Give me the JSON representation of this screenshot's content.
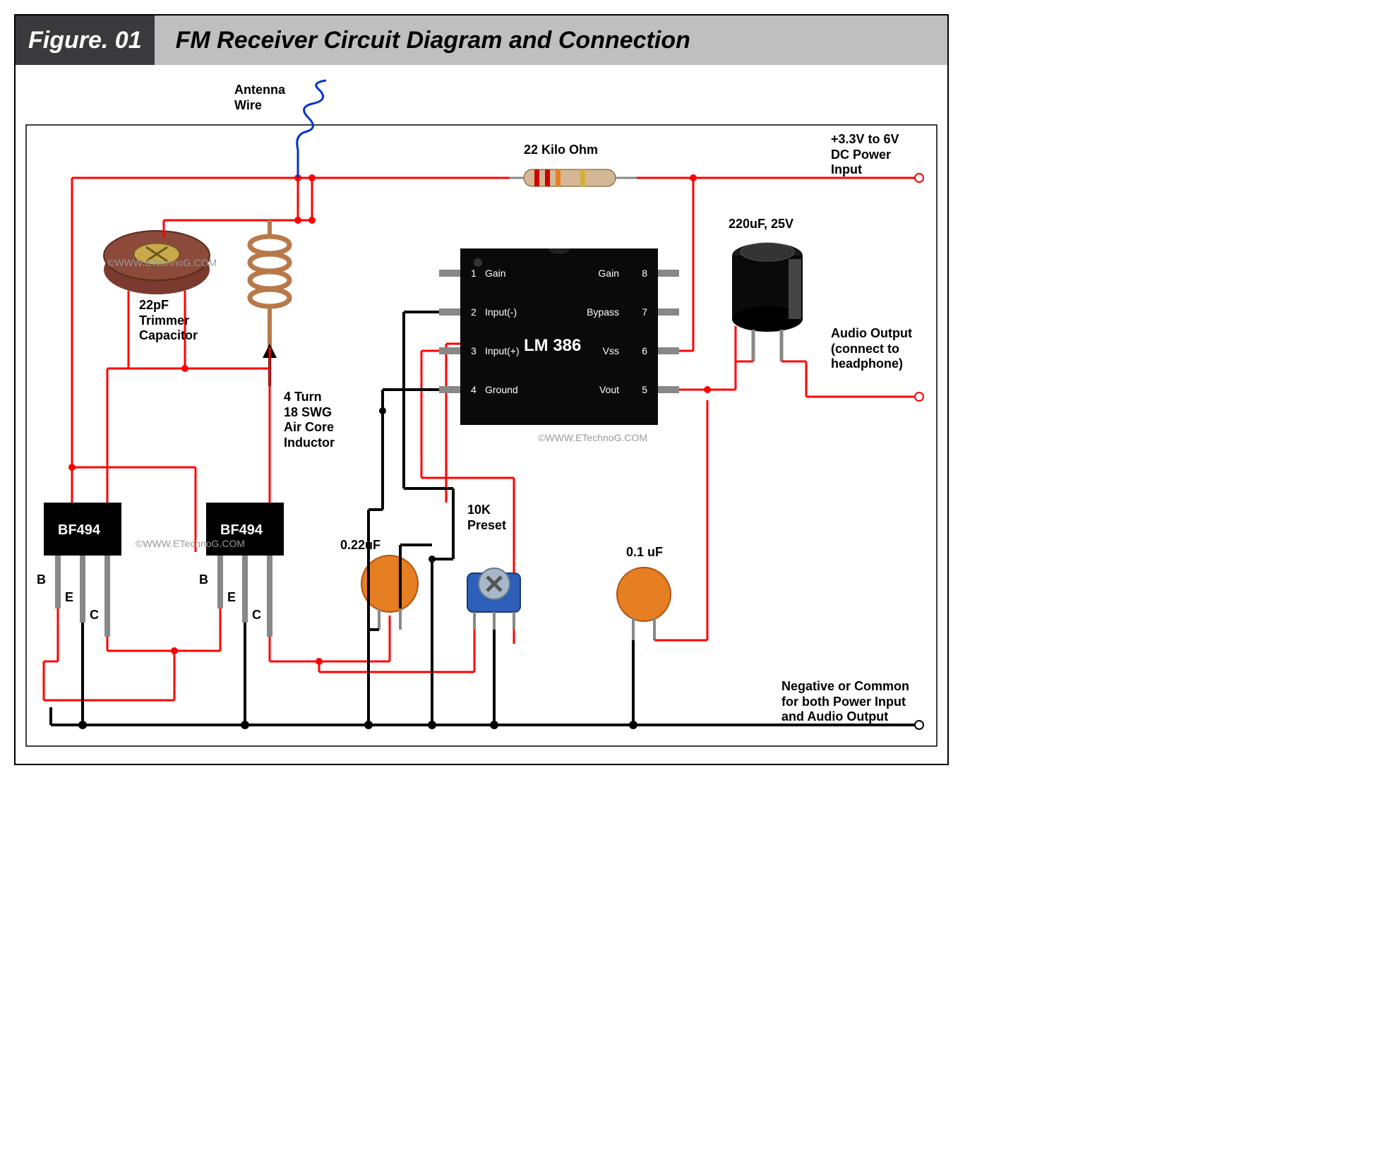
{
  "header": {
    "figure_label": "Figure. 01",
    "title": "FM Receiver Circuit Diagram and Connection"
  },
  "components": {
    "antenna": "Antenna\nWire",
    "resistor": "22 Kilo Ohm",
    "power_in": "+3.3V to 6V\nDC Power\nInput",
    "trimmer": "22pF\nTrimmer\nCapacitor",
    "inductor": "4 Turn\n18 SWG\nAir Core\nInductor",
    "ecap": "220uF, 25V",
    "audio_out": "Audio Output\n(connect to\nheadphone)",
    "preset": "10K\nPreset",
    "c022": "0.22uF",
    "c01": "0.1 uF",
    "neg_out": "Negative or Common\nfor both Power Input\nand Audio Output",
    "transistor1": "BF494",
    "transistor2": "BF494",
    "pins": {
      "b": "B",
      "e": "E",
      "c": "C"
    }
  },
  "ic": {
    "name": "LM 386",
    "pins": {
      "1": "Gain",
      "2": "Input(-)",
      "3": "Input(+)",
      "4": "Ground",
      "5": "Vout",
      "6": "Vss",
      "7": "Bypass",
      "8": "Gain"
    }
  },
  "watermark": "©WWW.ETechnoG.COM"
}
